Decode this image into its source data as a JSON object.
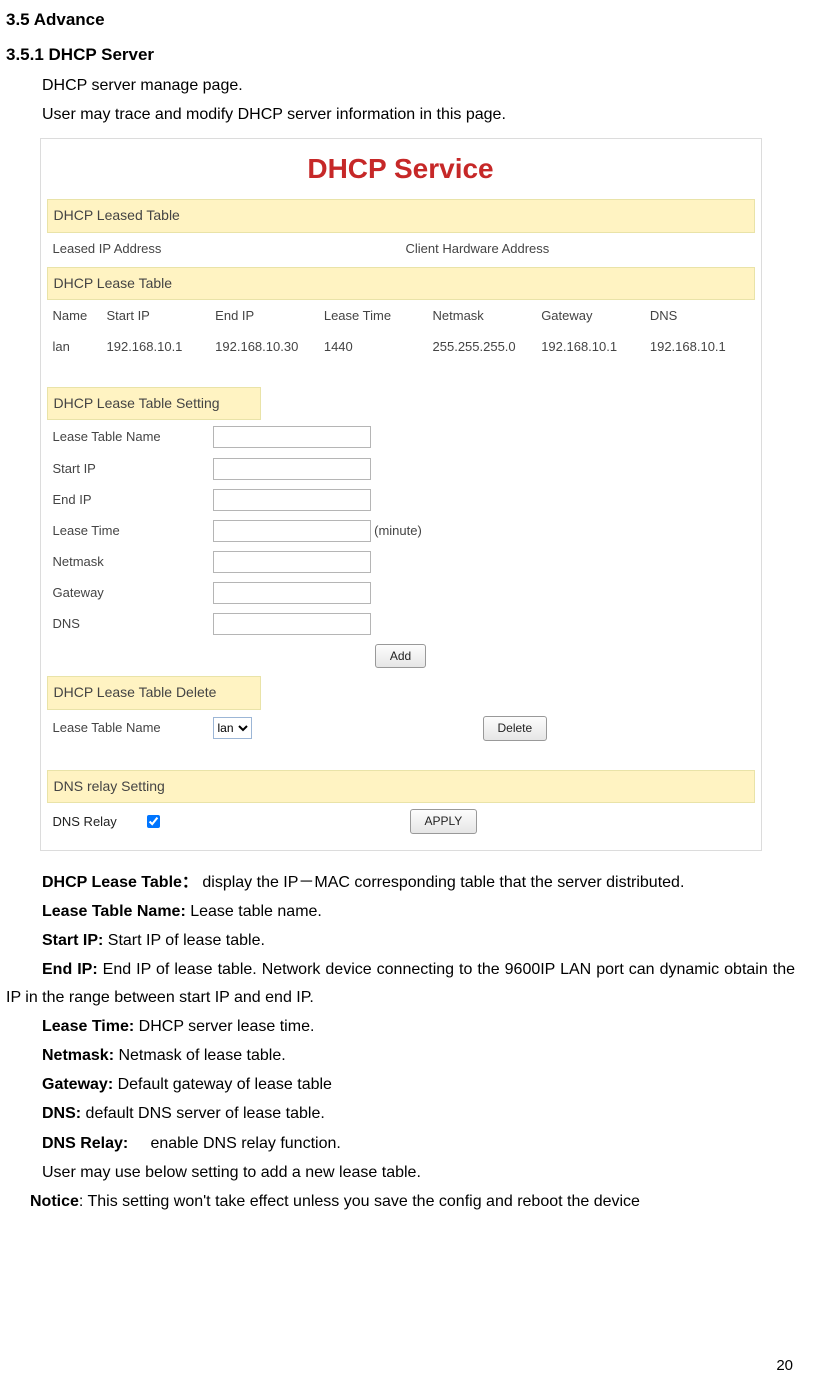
{
  "headings": {
    "h35": "3.5 Advance",
    "h351": "3.5.1 DHCP Server"
  },
  "intro": {
    "line1": "DHCP server manage page.",
    "line2": "User may trace and modify DHCP server information in this page."
  },
  "figure": {
    "title": "DHCP Service",
    "leased_table": {
      "header": "DHCP Leased Table",
      "col1": "Leased IP Address",
      "col2": "Client Hardware Address"
    },
    "lease_table": {
      "header": "DHCP Lease Table",
      "cols": {
        "c1": "Name",
        "c2": "Start IP",
        "c3": "End IP",
        "c4": "Lease Time",
        "c5": "Netmask",
        "c6": "Gateway",
        "c7": "DNS"
      },
      "row": {
        "c1": "lan",
        "c2": "192.168.10.1",
        "c3": "192.168.10.30",
        "c4": "1440",
        "c5": "255.255.255.0",
        "c6": "192.168.10.1",
        "c7": "192.168.10.1"
      }
    },
    "lease_setting": {
      "header": "DHCP Lease Table Setting",
      "lease_table_name": "Lease Table Name",
      "start_ip": "Start IP",
      "end_ip": "End IP",
      "lease_time": "Lease Time",
      "lease_time_suffix": "(minute)",
      "netmask": "Netmask",
      "gateway": "Gateway",
      "dns": "DNS",
      "add_btn": "Add"
    },
    "lease_delete": {
      "header": "DHCP Lease Table Delete",
      "label": "Lease Table Name",
      "option": "lan",
      "delete_btn": "Delete"
    },
    "dns_relay": {
      "header": "DNS relay Setting",
      "label": "DNS Relay",
      "apply_btn": "APPLY"
    }
  },
  "descriptions": {
    "d1_prefix": "DHCP Lease Table：",
    "d1_body": " display the IP－MAC corresponding table that the server distributed.",
    "d2_prefix": "Lease Table Name:",
    "d2_body": " Lease table name.",
    "d3_prefix": "Start IP:",
    "d3_body": " Start IP of lease table.",
    "d4_prefix": "End IP:",
    "d4_body": " End IP of lease table. Network device connecting to the 9600IP LAN port can dynamic obtain the IP in the range between start IP and end IP.",
    "d5_prefix": "Lease Time:",
    "d5_body": " DHCP server lease time.",
    "d6_prefix": "Netmask:",
    "d6_body": " Netmask of lease table.",
    "d7_prefix": "Gateway:",
    "d7_body": " Default gateway of lease table",
    "d8_prefix": "DNS:",
    "d8_body": " default DNS server of lease table.",
    "d9_prefix": "DNS Relay:",
    "d9_body": "     enable DNS relay function.",
    "d10": "User may use below setting to add a new lease table.",
    "notice_prefix": "Notice",
    "notice_body": ": This setting won't take effect unless you save the config and reboot the device"
  },
  "page_number": "20"
}
